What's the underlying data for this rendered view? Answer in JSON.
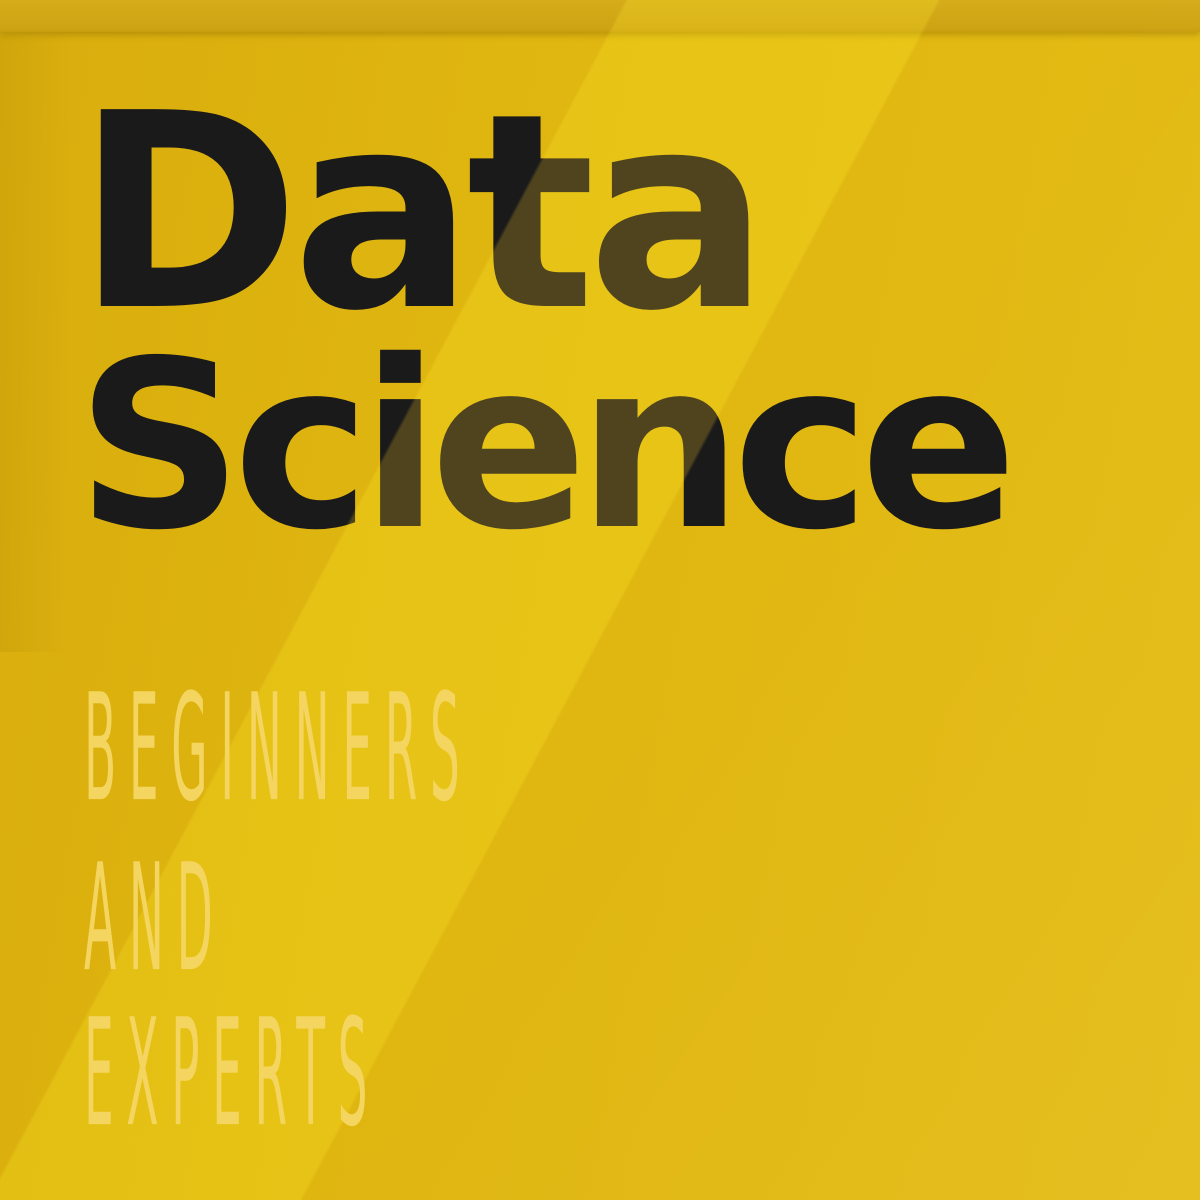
{
  "colors": {
    "background": "#dfb510",
    "headline": "#1a1a1a",
    "subtitle": "#f4d560"
  },
  "title": {
    "line1": "Data",
    "line2": "Science"
  },
  "subtitle": {
    "line1": "BEGINNERS",
    "line2": "AND",
    "line3": "EXPERTS"
  }
}
